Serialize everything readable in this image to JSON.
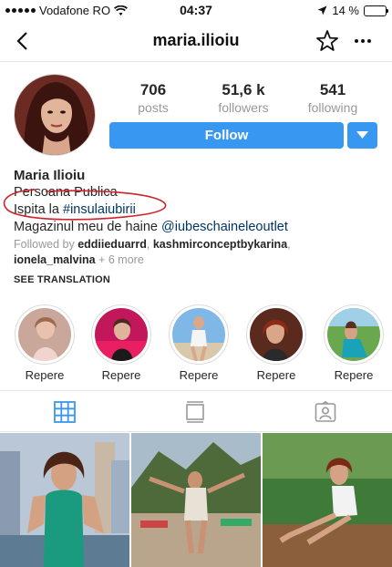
{
  "status_bar": {
    "carrier": "Vodafone RO",
    "time": "04:37",
    "battery_text": "14 %",
    "battery_level": 0.14
  },
  "nav": {
    "username": "maria.ilioiu"
  },
  "stats": {
    "posts": {
      "value": "706",
      "label": "posts"
    },
    "followers": {
      "value": "51,6 k",
      "label": "followers"
    },
    "following": {
      "value": "541",
      "label": "following"
    }
  },
  "follow_button": {
    "label": "Follow"
  },
  "bio": {
    "name": "Maria Ilioiu",
    "line1": "Persoana Publica",
    "line2_prefix": "Ispita la ",
    "line2_tag": "#insulaiubirii",
    "line3_prefix": "Magazinul meu de haine ",
    "line3_mention": "@iubeschaineleoutlet"
  },
  "followed_by": {
    "prefix": "Followed by ",
    "user1": "eddiieduarrd",
    "sep1": ", ",
    "user2": "kashmirconceptbykarina",
    "sep2": ",",
    "user3": "ionela_malvina",
    "suffix": " + 6 more"
  },
  "see_translation": "SEE TRANSLATION",
  "highlights": [
    {
      "label": "Repere"
    },
    {
      "label": "Repere"
    },
    {
      "label": "Repere"
    },
    {
      "label": "Repere"
    },
    {
      "label": "Repere"
    }
  ],
  "colors": {
    "accent": "#3897f0",
    "muted": "#999999",
    "hashtag": "#003569",
    "annotation": "#d0202a"
  },
  "icons": {
    "nav": [
      "back-chevron-icon",
      "star-icon",
      "more-dots-icon"
    ],
    "tabs": [
      "grid-icon",
      "feed-list-icon",
      "tagged-user-icon"
    ]
  }
}
